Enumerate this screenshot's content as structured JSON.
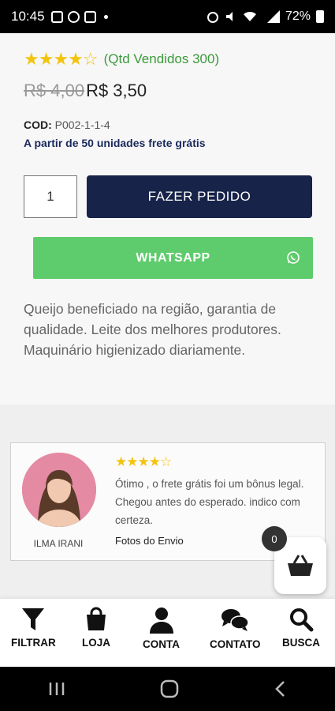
{
  "status": {
    "time": "10:45",
    "battery": "72%"
  },
  "product": {
    "stars": "★★★★☆",
    "sold": "(Qtd Vendidos 300)",
    "old_price": "R$ 4,00",
    "new_price": "R$ 3,50",
    "cod_label": "COD:",
    "cod_value": "P002-1-1-4",
    "shipping": "A partir de 50 unidades frete grátis",
    "quantity": "1",
    "order_label": "FAZER PEDIDO",
    "whatsapp_label": "WHATSAPP",
    "description": "Queijo beneficiado na região, garantia de qualidade. Leite dos melhores produtores. Maquinário higienizado diariamente."
  },
  "review": {
    "name": "ILMA IRANI",
    "stars": "★★★★☆",
    "text": "Ótimo , o frete grátis foi um bônus legal. Chegou antes do esperado. indico com certeza.",
    "photos_label": "Fotos do Envio"
  },
  "cart": {
    "count": "0"
  },
  "nav": {
    "filter": "FILTRAR",
    "store": "LOJA",
    "account": "CONTA",
    "contact": "CONTATO",
    "search": "BUSCA"
  },
  "colors": {
    "primary": "#172349",
    "whatsapp": "#5ecb6c",
    "star": "#f3c40f",
    "sold": "#3a9a3a"
  }
}
